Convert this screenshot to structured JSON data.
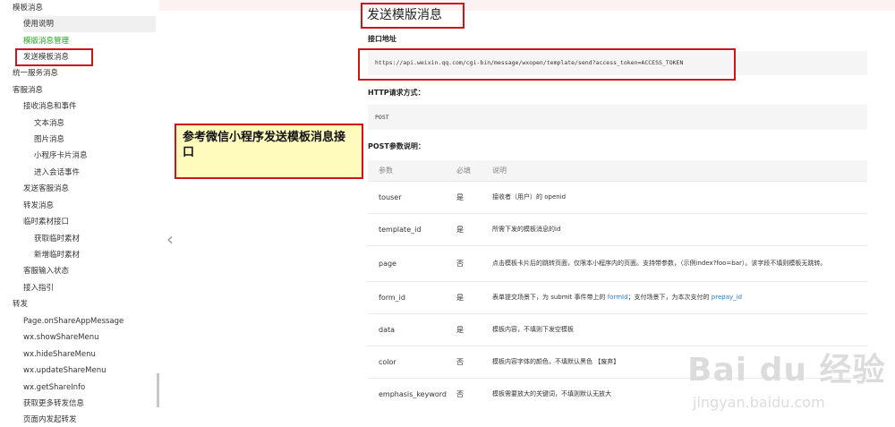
{
  "sidebar": {
    "items": [
      {
        "label": "模板消息",
        "level": 0
      },
      {
        "label": "使用说明",
        "level": 1
      },
      {
        "label": "模版消息管理",
        "level": 1,
        "active": true
      },
      {
        "label": "发送模板消息",
        "level": 1,
        "selected": true
      },
      {
        "label": "统一服务消息",
        "level": 0
      },
      {
        "label": "客服消息",
        "level": 0
      },
      {
        "label": "接收消息和事件",
        "level": 1
      },
      {
        "label": "文本消息",
        "level": 2
      },
      {
        "label": "图片消息",
        "level": 2
      },
      {
        "label": "小程序卡片消息",
        "level": 2
      },
      {
        "label": "进入会话事件",
        "level": 2
      },
      {
        "label": "发送客服消息",
        "level": 1
      },
      {
        "label": "转发消息",
        "level": 1
      },
      {
        "label": "临时素材接口",
        "level": 1
      },
      {
        "label": "获取临时素材",
        "level": 2
      },
      {
        "label": "新增临时素材",
        "level": 2
      },
      {
        "label": "客服输入状态",
        "level": 1
      },
      {
        "label": "接入指引",
        "level": 1
      },
      {
        "label": "转发",
        "level": 0
      },
      {
        "label": "Page.onShareAppMessage",
        "level": 1
      },
      {
        "label": "wx.showShareMenu",
        "level": 1
      },
      {
        "label": "wx.hideShareMenu",
        "level": 1
      },
      {
        "label": "wx.updateShareMenu",
        "level": 1
      },
      {
        "label": "wx.getShareInfo",
        "level": 1
      },
      {
        "label": "获取更多转发信息",
        "level": 1
      },
      {
        "label": "页面内发起转发",
        "level": 1
      }
    ]
  },
  "main": {
    "title": "发送模版消息",
    "endpoint_label": "接口地址",
    "endpoint_url": "https://api.weixin.qq.com/cgi-bin/message/wxopen/template/send?access_token=ACCESS_TOKEN",
    "method_label": "HTTP请求方式：",
    "method": "POST",
    "params_label": "POST参数说明：",
    "table": {
      "headers": [
        "参数",
        "必填",
        "说明"
      ],
      "rows": [
        {
          "param": "touser",
          "required": "是",
          "desc": "接收者（用户）的 openid"
        },
        {
          "param": "template_id",
          "required": "是",
          "desc": "所需下发的模板消息的id"
        },
        {
          "param": "page",
          "required": "否",
          "desc": "点击模板卡片后的跳转页面，仅限本小程序内的页面。支持带参数，（示例index?foo=bar）。该字段不填则模板无跳转。"
        },
        {
          "param": "form_id",
          "required": "是",
          "desc_a": "表单提交场景下，为 submit 事件带上的 ",
          "desc_link1": "formId",
          "desc_b": "；支付场景下，为本次支付的 ",
          "desc_link2": "prepay_id"
        },
        {
          "param": "data",
          "required": "是",
          "desc": "模板内容，不填则下发空模板"
        },
        {
          "param": "color",
          "required": "否",
          "desc": "模板内容字体的颜色，不填默认黑色 【废弃】"
        },
        {
          "param": "emphasis_keyword",
          "required": "否",
          "desc": "模板需要放大的关键词，不填则默认无放大"
        }
      ]
    }
  },
  "annotation": {
    "text": "参考微信小程序发送模板消息接口"
  },
  "watermark": {
    "main": "Bai du 经验",
    "sub": "jingyan.baidu.com"
  },
  "icons": {
    "back": "chevron-left-icon"
  },
  "colors": {
    "highlight_border": "#d0121b",
    "note_bg": "#fffbbd",
    "active_link": "#1aad19",
    "link": "#2b7bd6"
  }
}
